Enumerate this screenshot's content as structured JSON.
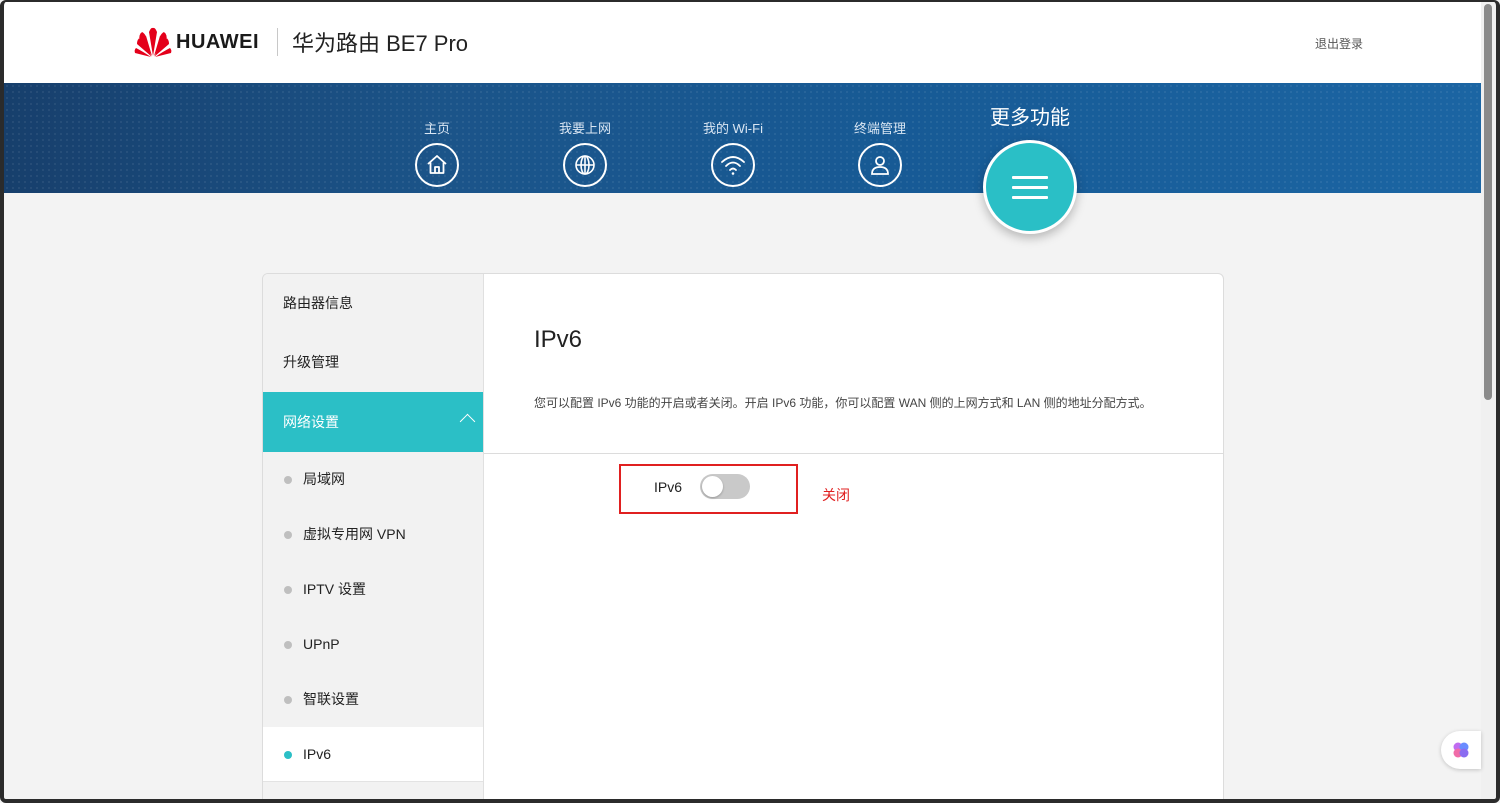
{
  "header": {
    "brand": "HUAWEI",
    "product": "华为路由 BE7 Pro",
    "logout": "退出登录"
  },
  "nav": {
    "items": [
      {
        "label": "主页",
        "icon": "home-icon"
      },
      {
        "label": "我要上网",
        "icon": "globe-icon"
      },
      {
        "label": "我的 Wi-Fi",
        "icon": "wifi-icon"
      },
      {
        "label": "终端管理",
        "icon": "user-icon"
      }
    ],
    "more": {
      "label": "更多功能",
      "icon": "menu-icon"
    }
  },
  "sidebar": {
    "top_items": [
      "路由器信息",
      "升级管理"
    ],
    "group": "网络设置",
    "sub_items": [
      "局域网",
      "虚拟专用网 VPN",
      "IPTV 设置",
      "UPnP",
      "智联设置",
      "IPv6"
    ],
    "active": "IPv6"
  },
  "main": {
    "title": "IPv6",
    "description": "您可以配置 IPv6 功能的开启或者关闭。开启 IPv6 功能，你可以配置 WAN 侧的上网方式和 LAN 侧的地址分配方式。",
    "toggle_label": "IPv6",
    "toggle_on": false,
    "status": "关闭"
  },
  "colors": {
    "accent": "#2bbfc6",
    "banner": "#1b5489",
    "highlight": "#e02020"
  }
}
